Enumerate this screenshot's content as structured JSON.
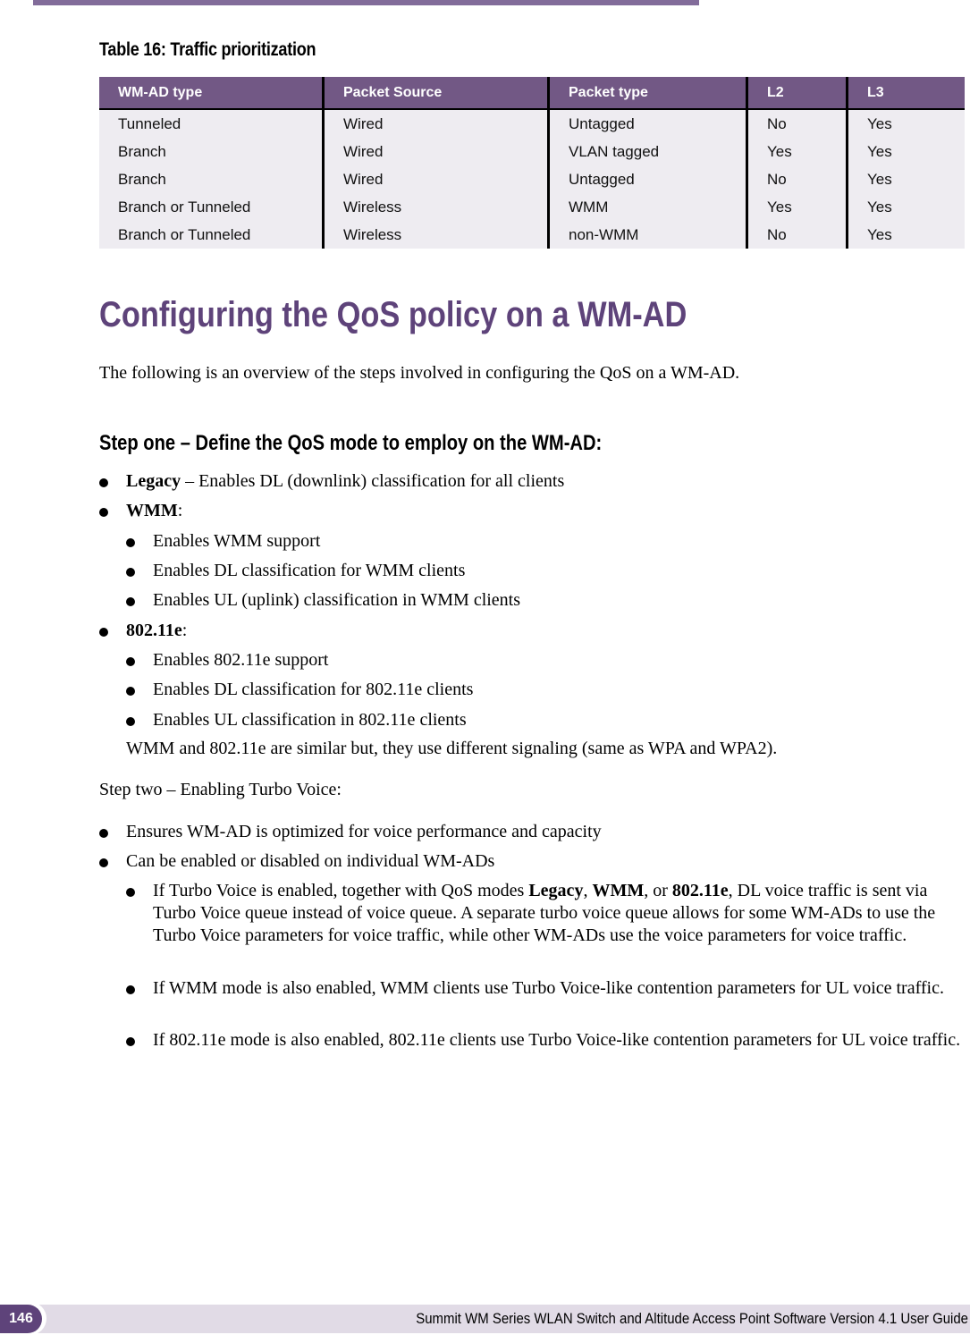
{
  "table": {
    "caption": "Table 16:  Traffic prioritization",
    "headers": [
      "WM-AD type",
      "Packet Source",
      "Packet type",
      "L2",
      "L3"
    ],
    "rows": [
      [
        "Tunneled",
        "Wired",
        "Untagged",
        "No",
        "Yes"
      ],
      [
        "Branch",
        "Wired",
        "VLAN tagged",
        "Yes",
        "Yes"
      ],
      [
        "Branch",
        "Wired",
        "Untagged",
        "No",
        "Yes"
      ],
      [
        "Branch or Tunneled",
        "Wireless",
        "WMM",
        "Yes",
        "Yes"
      ],
      [
        "Branch or Tunneled",
        "Wireless",
        "non-WMM",
        "No",
        "Yes"
      ]
    ]
  },
  "section": {
    "title": "Configuring the QoS policy on a WM-AD",
    "intro": "The following is an overview of the steps involved in configuring the QoS on a WM-AD.",
    "step_one_heading": "Step one – Define the QoS mode to employ on the WM-AD:",
    "legacy": {
      "term": "Legacy",
      "text": " – Enables DL (downlink) classification for all clients"
    },
    "wmm": {
      "term": "WMM",
      "suffix": ":",
      "items": [
        "Enables WMM support",
        "Enables DL classification for WMM clients",
        "Enables UL (uplink) classification in WMM clients"
      ]
    },
    "e80211": {
      "term": "802.11e",
      "suffix": ":",
      "items": [
        "Enables 802.11e support",
        "Enables DL classification for 802.11e clients",
        "Enables UL classification in 802.11e clients"
      ]
    },
    "note": "WMM and 802.11e are similar but, they use different signaling (same as WPA and WPA2).",
    "step_two": "Step two – Enabling Turbo Voice:",
    "step_two_items": [
      "Ensures WM-AD is optimized for voice performance and capacity",
      "Can be enabled or disabled on individual WM-ADs"
    ],
    "turbo": {
      "p1_a": "If Turbo Voice is enabled, together with QoS modes ",
      "p1_b1": "Legacy",
      "p1_c1": ", ",
      "p1_b2": "WMM",
      "p1_c2": ", or ",
      "p1_b3": "802.11e",
      "p1_d": ", DL voice traffic is sent via Turbo Voice queue instead of voice queue. A separate turbo voice queue allows for some WM-ADs to use the Turbo Voice parameters for voice traffic, while other WM-ADs use the voice parameters for voice traffic.",
      "p2": "If WMM mode is also enabled, WMM clients use Turbo Voice-like contention parameters for UL voice traffic.",
      "p3": "If 802.11e mode is also enabled, 802.11e clients use Turbo Voice-like contention parameters for UL voice traffic."
    }
  },
  "footer": {
    "page_number": "146",
    "guide_title": "Summit WM Series WLAN Switch and Altitude Access Point Software Version 4.1 User Guide"
  },
  "colors": {
    "accent": "#5e437a",
    "header_bg": "#725885",
    "row_bg": "#eeecf1",
    "footer_bg": "#e1dbe6"
  }
}
